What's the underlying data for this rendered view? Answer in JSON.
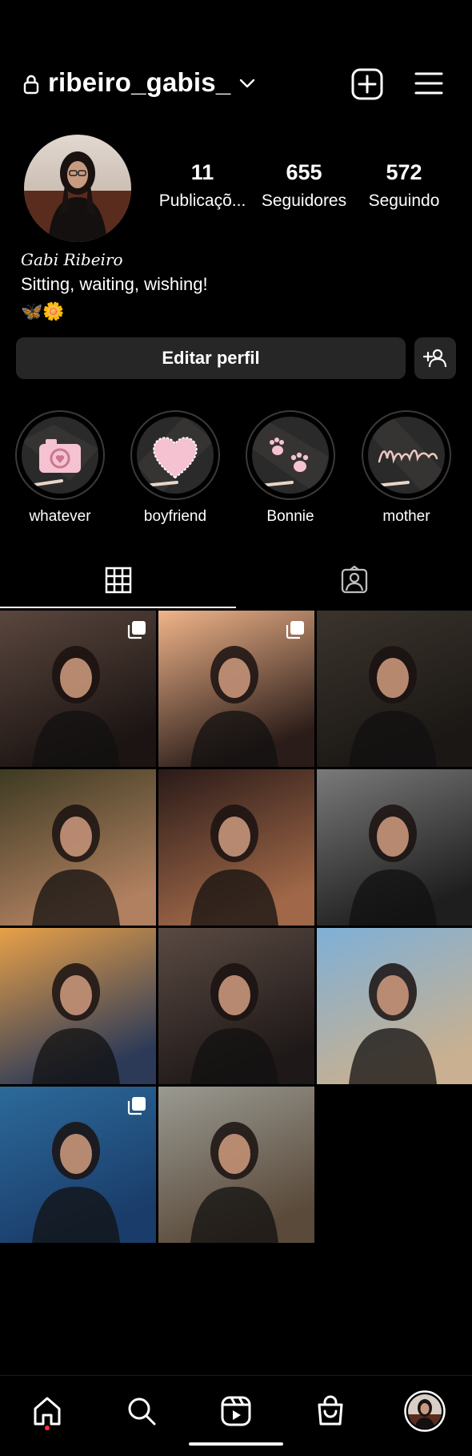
{
  "header": {
    "username": "ribeiro_gabis_"
  },
  "profile": {
    "stats": [
      {
        "value": "11",
        "label": "Publicaçõ..."
      },
      {
        "value": "655",
        "label": "Seguidores"
      },
      {
        "value": "572",
        "label": "Seguindo"
      }
    ],
    "name": "Gabi Ribeiro",
    "bio": "Sitting, waiting, wishing!",
    "emoji": "🦋🌼"
  },
  "buttons": {
    "edit_profile": "Editar perfil"
  },
  "highlights": [
    {
      "label": "whatever",
      "icon": "camera-icon"
    },
    {
      "label": "boyfriend",
      "icon": "heart-icon"
    },
    {
      "label": "Bonnie",
      "icon": "paw-icon"
    },
    {
      "label": "mother",
      "icon": "mother-script-icon"
    }
  ],
  "tabs": [
    "grid-icon",
    "tagged-icon"
  ],
  "grid": {
    "posts": [
      {
        "row": 0,
        "col": 0,
        "multiple": true,
        "colors": [
          "#5a463e",
          "#1b1412"
        ]
      },
      {
        "row": 0,
        "col": 1,
        "multiple": true,
        "colors": [
          "#f0b48a",
          "#2a1c18"
        ]
      },
      {
        "row": 0,
        "col": 2,
        "multiple": false,
        "colors": [
          "#3b342d",
          "#1a1714"
        ]
      },
      {
        "row": 1,
        "col": 0,
        "multiple": false,
        "colors": [
          "#3d3a22",
          "#b08060"
        ]
      },
      {
        "row": 1,
        "col": 1,
        "multiple": false,
        "colors": [
          "#2a1a18",
          "#a06848"
        ]
      },
      {
        "row": 1,
        "col": 2,
        "multiple": false,
        "colors": [
          "#7a7a7a",
          "#1e1e1e"
        ]
      },
      {
        "row": 2,
        "col": 0,
        "multiple": false,
        "colors": [
          "#e8a048",
          "#2c3a58"
        ]
      },
      {
        "row": 2,
        "col": 1,
        "multiple": false,
        "colors": [
          "#5a4a42",
          "#1e1818"
        ]
      },
      {
        "row": 2,
        "col": 2,
        "multiple": false,
        "colors": [
          "#7eb0d8",
          "#c8b090"
        ]
      },
      {
        "row": 3,
        "col": 0,
        "multiple": true,
        "colors": [
          "#2c6a9a",
          "#1a3c6a"
        ]
      },
      {
        "row": 3,
        "col": 1,
        "multiple": false,
        "colors": [
          "#9a9a92",
          "#5a4a3a"
        ]
      }
    ]
  },
  "nav": [
    "home-icon",
    "search-icon",
    "reels-icon",
    "shop-icon",
    "profile-avatar"
  ],
  "colors": {
    "background": "#000000",
    "button": "#262626",
    "notification_dot": "#ff3040"
  }
}
